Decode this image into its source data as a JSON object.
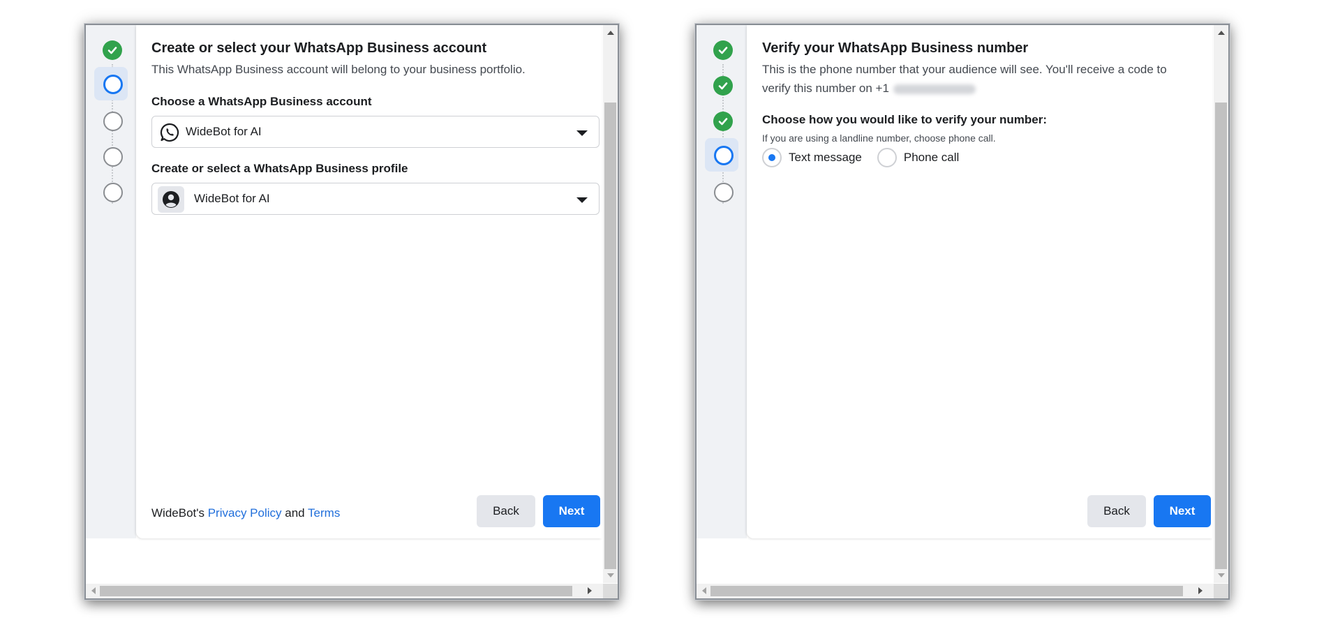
{
  "left_panel": {
    "title": "Create or select your WhatsApp Business account",
    "subtitle": "This WhatsApp Business account will belong to your business portfolio.",
    "account_label": "Choose a WhatsApp Business account",
    "account_value": "WideBot for AI",
    "profile_label": "Create or select a WhatsApp Business profile",
    "profile_value": "WideBot for AI",
    "footer_prefix": "WideBot's ",
    "privacy_link": "Privacy Policy",
    "footer_and": " and ",
    "terms_link": "Terms",
    "back_label": "Back",
    "next_label": "Next",
    "steps": [
      "done",
      "current",
      "todo",
      "todo",
      "todo"
    ]
  },
  "right_panel": {
    "title": "Verify your WhatsApp Business number",
    "subtitle_line1": "This is the phone number that your audience will see. You'll receive a code to",
    "subtitle_line2": "verify this number on +1",
    "choose_label": "Choose how you would like to verify your number:",
    "hint": "If you are using a landline number, choose phone call.",
    "option_text": "Text message",
    "option_call": "Phone call",
    "selected_option": "Text message",
    "back_label": "Back",
    "next_label": "Next",
    "steps": [
      "done",
      "done",
      "done",
      "current",
      "todo"
    ]
  },
  "colors": {
    "accent": "#1877f2",
    "success": "#31a24c",
    "link": "#216fdb"
  }
}
